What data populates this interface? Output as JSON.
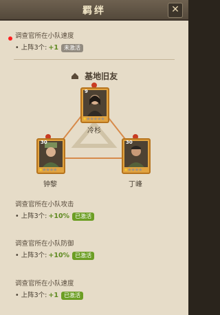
{
  "header": {
    "title": "羁绊",
    "close_glyph": "✕"
  },
  "top_entry": {
    "desc": "调查官所在小队速度",
    "stat": "上阵3个:",
    "value": "+1",
    "badge": "未激活"
  },
  "section": {
    "title": "基地旧友"
  },
  "heroes": [
    {
      "name": "冷杉",
      "level": "9",
      "stars": "★★★★★",
      "lit_stars": "★"
    },
    {
      "name": "钟黎",
      "level": "30",
      "stars": "★★★★",
      "lit_stars": "★"
    },
    {
      "name": "丁峰",
      "level": "30",
      "stars": "★★★★",
      "lit_stars": "★"
    }
  ],
  "bonuses": [
    {
      "desc": "调查官所在小队攻击",
      "stat": "上阵3个:",
      "value": "+10%",
      "badge": "已激活"
    },
    {
      "desc": "调查官所在小队防御",
      "stat": "上阵3个:",
      "value": "+10%",
      "badge": "已激活"
    },
    {
      "desc": "调查官所在小队速度",
      "stat": "上阵3个:",
      "value": "+1",
      "badge": "已激活"
    }
  ],
  "colors": {
    "accent": "#6c9e24",
    "inactive": "#928b80"
  }
}
